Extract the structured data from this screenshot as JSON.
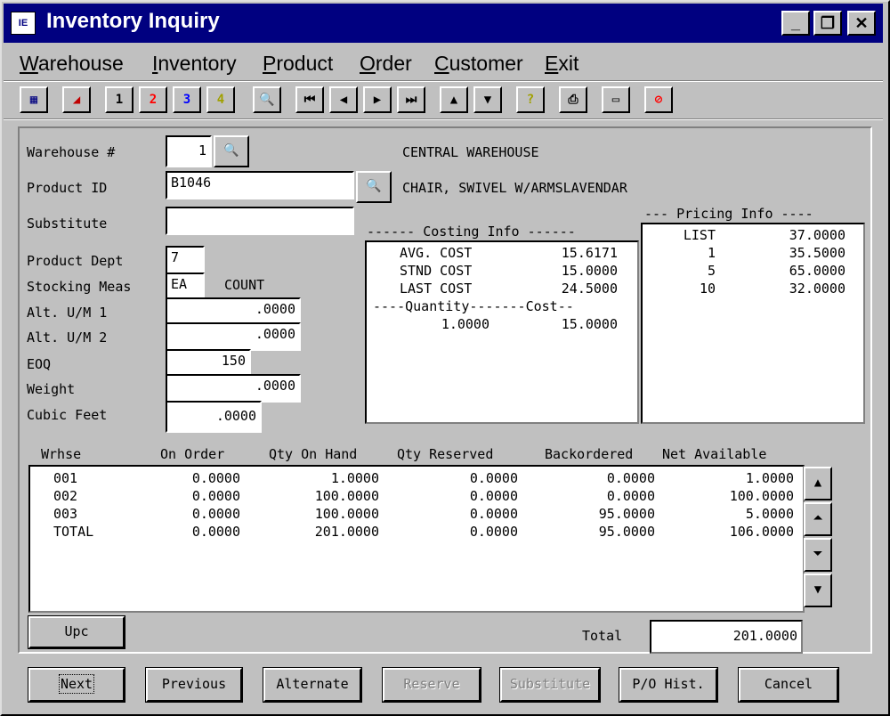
{
  "window": {
    "title": "Inventory Inquiry",
    "icon_label": "IE",
    "controls": {
      "minimize": "_",
      "restore": "❐",
      "close": "✕"
    }
  },
  "menu": [
    "Warehouse",
    "Inventory",
    "Product",
    "Order",
    "Customer",
    "Exit"
  ],
  "toolbar": [
    {
      "name": "grid-icon",
      "glyph": "▦",
      "color": "#000080"
    },
    {
      "name": "eraser-icon",
      "glyph": "◢",
      "color": "#c00000"
    },
    {
      "name": "tab-1-button",
      "glyph": "1",
      "color": "#000000"
    },
    {
      "name": "tab-2-button",
      "glyph": "2",
      "color": "#ff0000"
    },
    {
      "name": "tab-3-button",
      "glyph": "3",
      "color": "#0000ff"
    },
    {
      "name": "tab-4-button",
      "glyph": "4",
      "color": "#a0a000"
    },
    {
      "name": "search-icon",
      "glyph": "🔍",
      "color": "#000000"
    },
    {
      "name": "first-record-icon",
      "glyph": "⏮",
      "color": "#000000"
    },
    {
      "name": "previous-record-icon",
      "glyph": "◀",
      "color": "#000000"
    },
    {
      "name": "next-record-icon",
      "glyph": "▶",
      "color": "#000000"
    },
    {
      "name": "last-record-icon",
      "glyph": "⏭",
      "color": "#000000"
    },
    {
      "name": "up-icon",
      "glyph": "▲",
      "color": "#000000"
    },
    {
      "name": "down-icon",
      "glyph": "▼",
      "color": "#000000"
    },
    {
      "name": "help-icon",
      "glyph": "?",
      "color": "#a0a000"
    },
    {
      "name": "print-icon",
      "glyph": "⎙",
      "color": "#000000"
    },
    {
      "name": "keyboard-icon",
      "glyph": "▭",
      "color": "#000000"
    },
    {
      "name": "stop-icon",
      "glyph": "⊘",
      "color": "#ff0000"
    }
  ],
  "form": {
    "warehouse_label": "Warehouse #",
    "warehouse_value": "1",
    "warehouse_name": "CENTRAL WAREHOUSE",
    "product_id_label": "Product ID",
    "product_id_value": "B1046",
    "product_desc": "CHAIR, SWIVEL W/ARMSLAVENDAR",
    "substitute_label": "Substitute",
    "substitute_value": "",
    "product_dept_label": "Product Dept",
    "product_dept_value": "7",
    "stocking_meas_label": "Stocking Meas",
    "stocking_meas_value": "EA",
    "stocking_meas_desc": "COUNT",
    "alt_um1_label": "Alt. U/M 1",
    "alt_um1_value": ".0000",
    "alt_um2_label": "Alt. U/M 2",
    "alt_um2_value": ".0000",
    "eoq_label": "EOQ",
    "eoq_value": "150",
    "weight_label": "Weight",
    "weight_value": ".0000",
    "cubic_feet_label": "Cubic Feet",
    "cubic_feet_value": ".0000"
  },
  "costing": {
    "header": "------ Costing Info ------",
    "rows": [
      {
        "label": "AVG. COST",
        "value": "15.6171"
      },
      {
        "label": "STND COST",
        "value": "15.0000"
      },
      {
        "label": "LAST COST",
        "value": "24.5000"
      }
    ],
    "qty_header": "----Quantity-------Cost--",
    "qty_rows": [
      {
        "qty": "1.0000",
        "cost": "15.0000"
      }
    ]
  },
  "pricing": {
    "header": "--- Pricing Info ----",
    "rows": [
      {
        "qty": "LIST",
        "price": "37.0000"
      },
      {
        "qty": "1",
        "price": "35.5000"
      },
      {
        "qty": "5",
        "price": "65.0000"
      },
      {
        "qty": "10",
        "price": "32.0000"
      }
    ]
  },
  "stock_table": {
    "headers": [
      "Wrhse",
      "On Order",
      "Qty On Hand",
      "Qty Reserved",
      "Backordered",
      "Net Available"
    ],
    "rows": [
      [
        "001",
        "0.0000",
        "1.0000",
        "0.0000",
        "0.0000",
        "1.0000"
      ],
      [
        "002",
        "0.0000",
        "100.0000",
        "0.0000",
        "0.0000",
        "100.0000"
      ],
      [
        "003",
        "0.0000",
        "100.0000",
        "0.0000",
        "95.0000",
        "5.0000"
      ],
      [
        "TOTAL",
        "0.0000",
        "201.0000",
        "0.0000",
        "95.0000",
        "106.0000"
      ]
    ]
  },
  "upc_button": "Upc",
  "total_label": "Total",
  "total_value": "201.0000",
  "buttons": [
    {
      "label": "Next",
      "name": "next-button",
      "enabled": true,
      "focused": true
    },
    {
      "label": "Previous",
      "name": "previous-button",
      "enabled": true,
      "focused": false
    },
    {
      "label": "Alternate",
      "name": "alternate-button",
      "enabled": true,
      "focused": false
    },
    {
      "label": "Reserve",
      "name": "reserve-button",
      "enabled": false,
      "focused": false
    },
    {
      "label": "Substitute",
      "name": "substitute-button",
      "enabled": false,
      "focused": false
    },
    {
      "label": "P/O Hist.",
      "name": "po-history-button",
      "enabled": true,
      "focused": false
    },
    {
      "label": "Cancel",
      "name": "cancel-button",
      "enabled": true,
      "focused": false
    }
  ]
}
